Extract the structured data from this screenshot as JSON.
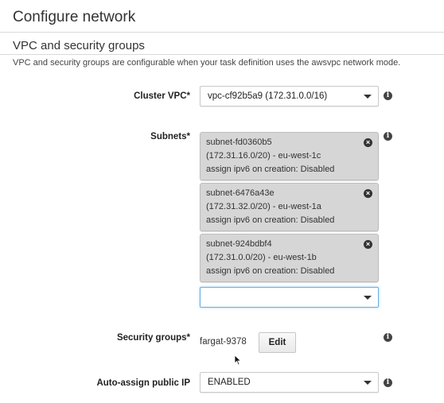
{
  "page_title": "Configure network",
  "section": {
    "title": "VPC and security groups",
    "description": "VPC and security groups are configurable when your task definition uses the awsvpc network mode."
  },
  "cluster_vpc": {
    "label": "Cluster VPC*",
    "value": "vpc-cf92b5a9 (172.31.0.0/16)",
    "icon": "info-icon"
  },
  "subnets": {
    "label": "Subnets*",
    "icon": "info-icon",
    "items": [
      {
        "id": "subnet-fd0360b5",
        "detail": "(172.31.16.0/20) - eu-west-1c",
        "ipv6": "assign ipv6 on creation: Disabled"
      },
      {
        "id": "subnet-6476a43e",
        "detail": "(172.31.32.0/20) - eu-west-1a",
        "ipv6": "assign ipv6 on creation: Disabled"
      },
      {
        "id": "subnet-924bdbf4",
        "detail": "(172.31.0.0/20) - eu-west-1b",
        "ipv6": "assign ipv6 on creation: Disabled"
      }
    ],
    "add_select_value": ""
  },
  "security_groups": {
    "label": "Security groups*",
    "value": "fargat-9378",
    "edit_label": "Edit",
    "icon": "info-icon"
  },
  "auto_assign_ip": {
    "label": "Auto-assign public IP",
    "value": "ENABLED",
    "icon": "info-icon"
  }
}
